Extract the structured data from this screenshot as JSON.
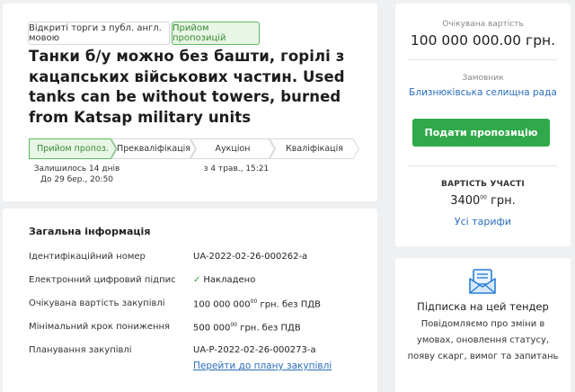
{
  "tender": {
    "procedure_tag": "Відкриті торги з публ. англ. мовою",
    "status_tag": "Прийом пропозицій",
    "title": "Танки б/у можно без башти, горілі з кацапських військових частин. Used tanks can be without towers, burned from Katsap military units"
  },
  "stages": [
    {
      "label": "Прийом пропоз.",
      "active": true
    },
    {
      "label": "Прекваліфікація",
      "active": false
    },
    {
      "label": "Аукціон",
      "active": false
    },
    {
      "label": "Кваліфікація",
      "active": false
    }
  ],
  "stage_notes": {
    "remaining": "Залишилось 14 днів",
    "until": "До 29 бер., 20:50",
    "auction_date": "з 4 трав., 15:21"
  },
  "info": {
    "heading": "Загальна інформація",
    "rows": [
      {
        "label": "Ідентифікаційний номер",
        "value": "UA-2022-02-26-000262-a"
      },
      {
        "label": "Електронний цифровий підпис",
        "value": "Накладено"
      },
      {
        "label": "Очікувана вартість закупівлі",
        "value_main": "100 000 000",
        "value_cents": "00",
        "value_suffix": "грн. без ПДВ"
      },
      {
        "label": "Мінімальний крок пониження",
        "value_main": "500 000",
        "value_cents": "00",
        "value_suffix": "грн. без ПДВ"
      },
      {
        "label": "Планування закупівлі",
        "value": "UA-P-2022-02-26-000273-a",
        "link": "Перейти до плану закупівлі"
      }
    ]
  },
  "sidebar": {
    "price_label": "Очікувана вартість",
    "price_value": "100 000 000.00 грн.",
    "customer_label": "Замовник",
    "customer_name": "Близнюківська селищна рада",
    "submit_button": "Подати пропозицію",
    "fee_label": "ВАРТІСТЬ УЧАСТІ",
    "fee_main": "3400",
    "fee_cents": "00",
    "fee_suffix": "грн.",
    "tariffs_link": "Усі тарифи"
  },
  "subscription": {
    "title": "Підписка на цей тендер",
    "text": "Повідомляємо про зміни в умовах, оновлення статусу, появу скарг, вимог та запитань"
  },
  "colors": {
    "accent_green": "#30a94a",
    "link_blue": "#2a6ebb",
    "active_stage_bg": "#e8f6e5",
    "active_stage_border": "#5cb85c"
  },
  "icons": {
    "signature_check": "check-icon",
    "subscription": "mail-icon"
  }
}
